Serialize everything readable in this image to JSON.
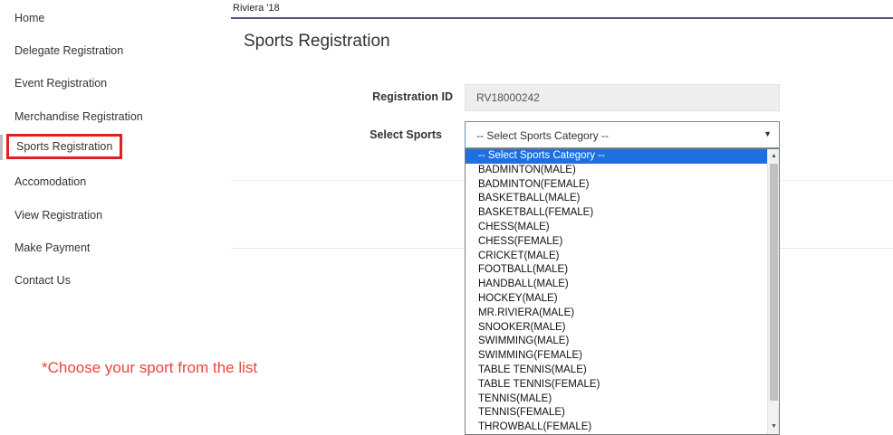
{
  "sidebar": {
    "items": [
      {
        "label": "Home"
      },
      {
        "label": "Delegate Registration"
      },
      {
        "label": "Event Registration"
      },
      {
        "label": "Merchandise Registration"
      },
      {
        "label": "Sports Registration"
      },
      {
        "label": "Accomodation"
      },
      {
        "label": "View Registration"
      },
      {
        "label": "Make Payment"
      },
      {
        "label": "Contact Us"
      }
    ],
    "active_item": "Sports Registration",
    "highlight_color": "#e02020"
  },
  "annotation": {
    "text": "*Choose your sport from the list",
    "color": "#e8453c"
  },
  "header": {
    "brand": "Riviera '18",
    "accent_color": "#5b4a86"
  },
  "form": {
    "title": "Sports Registration",
    "registration_id_label": "Registration ID",
    "registration_id_value": "RV18000242",
    "select_sports_label": "Select Sports",
    "select_sports_value": "-- Select Sports Category --",
    "dropdown_icon": "chevron-down-icon"
  },
  "dropdown": {
    "selected_color": "#1e6fe0",
    "options": [
      "-- Select Sports Category --",
      "BADMINTON(MALE)",
      "BADMINTON(FEMALE)",
      "BASKETBALL(MALE)",
      "BASKETBALL(FEMALE)",
      "CHESS(MALE)",
      "CHESS(FEMALE)",
      "CRICKET(MALE)",
      "FOOTBALL(MALE)",
      "HANDBALL(MALE)",
      "HOCKEY(MALE)",
      "MR.RIVIERA(MALE)",
      "SNOOKER(MALE)",
      "SWIMMING(MALE)",
      "SWIMMING(FEMALE)",
      "TABLE TENNIS(MALE)",
      "TABLE TENNIS(FEMALE)",
      "TENNIS(MALE)",
      "TENNIS(FEMALE)",
      "THROWBALL(FEMALE)"
    ]
  }
}
